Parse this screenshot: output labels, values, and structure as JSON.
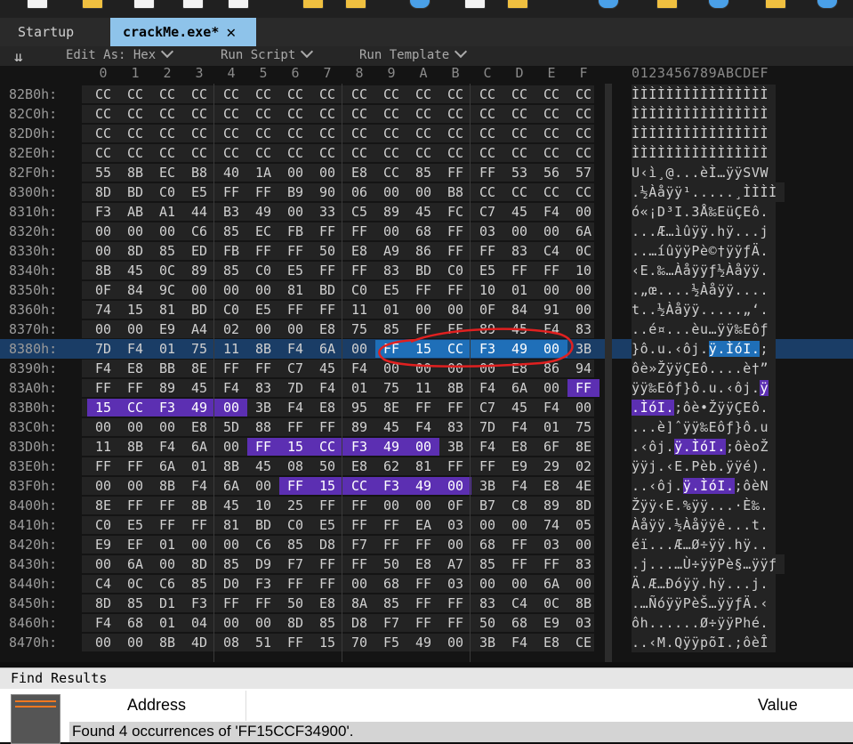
{
  "tabs": {
    "startup": "Startup",
    "active": "crackMe.exe*",
    "close_glyph": "✕"
  },
  "editor_bar": {
    "icon": "double-chevron-down-icon",
    "edit_as": "Edit As: Hex",
    "run_script": "Run Script",
    "run_template": "Run Template"
  },
  "columns": [
    "0",
    "1",
    "2",
    "3",
    "4",
    "5",
    "6",
    "7",
    "8",
    "9",
    "A",
    "B",
    "C",
    "D",
    "E",
    "F"
  ],
  "ascii_header": "0123456789ABCDEF",
  "rows": [
    {
      "addr": "82B0h:",
      "bytes": [
        "CC",
        "CC",
        "CC",
        "CC",
        "CC",
        "CC",
        "CC",
        "CC",
        "CC",
        "CC",
        "CC",
        "CC",
        "CC",
        "CC",
        "CC",
        "CC"
      ],
      "ascii": "ÌÌÌÌÌÌÌÌÌÌÌÌÌÌÌÌ"
    },
    {
      "addr": "82C0h:",
      "bytes": [
        "CC",
        "CC",
        "CC",
        "CC",
        "CC",
        "CC",
        "CC",
        "CC",
        "CC",
        "CC",
        "CC",
        "CC",
        "CC",
        "CC",
        "CC",
        "CC"
      ],
      "ascii": "ÌÌÌÌÌÌÌÌÌÌÌÌÌÌÌÌ"
    },
    {
      "addr": "82D0h:",
      "bytes": [
        "CC",
        "CC",
        "CC",
        "CC",
        "CC",
        "CC",
        "CC",
        "CC",
        "CC",
        "CC",
        "CC",
        "CC",
        "CC",
        "CC",
        "CC",
        "CC"
      ],
      "ascii": "ÌÌÌÌÌÌÌÌÌÌÌÌÌÌÌÌ"
    },
    {
      "addr": "82E0h:",
      "bytes": [
        "CC",
        "CC",
        "CC",
        "CC",
        "CC",
        "CC",
        "CC",
        "CC",
        "CC",
        "CC",
        "CC",
        "CC",
        "CC",
        "CC",
        "CC",
        "CC"
      ],
      "ascii": "ÌÌÌÌÌÌÌÌÌÌÌÌÌÌÌÌ"
    },
    {
      "addr": "82F0h:",
      "bytes": [
        "55",
        "8B",
        "EC",
        "B8",
        "40",
        "1A",
        "00",
        "00",
        "E8",
        "CC",
        "85",
        "FF",
        "FF",
        "53",
        "56",
        "57"
      ],
      "ascii": "U‹ì¸@...èÌ…ÿÿSVW"
    },
    {
      "addr": "8300h:",
      "bytes": [
        "8D",
        "BD",
        "C0",
        "E5",
        "FF",
        "FF",
        "B9",
        "90",
        "06",
        "00",
        "00",
        "B8",
        "CC",
        "CC",
        "CC",
        "CC"
      ],
      "ascii": ".½Àåÿÿ¹.....¸ÌÌÌÌ"
    },
    {
      "addr": "8310h:",
      "bytes": [
        "F3",
        "AB",
        "A1",
        "44",
        "B3",
        "49",
        "00",
        "33",
        "C5",
        "89",
        "45",
        "FC",
        "C7",
        "45",
        "F4",
        "00"
      ],
      "ascii": "ó«¡D³I.3Å‰EüÇEô."
    },
    {
      "addr": "8320h:",
      "bytes": [
        "00",
        "00",
        "00",
        "C6",
        "85",
        "EC",
        "FB",
        "FF",
        "FF",
        "00",
        "68",
        "FF",
        "03",
        "00",
        "00",
        "6A"
      ],
      "ascii": "...Æ…ìûÿÿ.hÿ...j"
    },
    {
      "addr": "8330h:",
      "bytes": [
        "00",
        "8D",
        "85",
        "ED",
        "FB",
        "FF",
        "FF",
        "50",
        "E8",
        "A9",
        "86",
        "FF",
        "FF",
        "83",
        "C4",
        "0C"
      ],
      "ascii": "..…íûÿÿPè©†ÿÿƒÄ."
    },
    {
      "addr": "8340h:",
      "bytes": [
        "8B",
        "45",
        "0C",
        "89",
        "85",
        "C0",
        "E5",
        "FF",
        "FF",
        "83",
        "BD",
        "C0",
        "E5",
        "FF",
        "FF",
        "10"
      ],
      "ascii": "‹E.‰…Àåÿÿƒ½Àåÿÿ."
    },
    {
      "addr": "8350h:",
      "bytes": [
        "0F",
        "84",
        "9C",
        "00",
        "00",
        "00",
        "81",
        "BD",
        "C0",
        "E5",
        "FF",
        "FF",
        "10",
        "01",
        "00",
        "00"
      ],
      "ascii": ".„œ....½Àåÿÿ...."
    },
    {
      "addr": "8360h:",
      "bytes": [
        "74",
        "15",
        "81",
        "BD",
        "C0",
        "E5",
        "FF",
        "FF",
        "11",
        "01",
        "00",
        "00",
        "0F",
        "84",
        "91",
        "00"
      ],
      "ascii": "t..½Àåÿÿ.....„‘."
    },
    {
      "addr": "8370h:",
      "bytes": [
        "00",
        "00",
        "E9",
        "A4",
        "02",
        "00",
        "00",
        "E8",
        "75",
        "85",
        "FF",
        "FF",
        "89",
        "45",
        "F4",
        "83"
      ],
      "ascii": "..é¤...èu…ÿÿ‰Eôƒ"
    },
    {
      "addr": "8380h:",
      "bytes": [
        "7D",
        "F4",
        "01",
        "75",
        "11",
        "8B",
        "F4",
        "6A",
        "00",
        "FF",
        "15",
        "CC",
        "F3",
        "49",
        "00",
        "3B"
      ],
      "ascii": "}ô.u.‹ôj.ÿ.ÌóI.;",
      "cursor": true,
      "sel": [
        9,
        14
      ],
      "asel": [
        9,
        14
      ]
    },
    {
      "addr": "8390h:",
      "bytes": [
        "F4",
        "E8",
        "BB",
        "8E",
        "FF",
        "FF",
        "C7",
        "45",
        "F4",
        "00",
        "00",
        "00",
        "00",
        "E8",
        "86",
        "94"
      ],
      "ascii": "ôè»ŽÿÿÇEô....è†”"
    },
    {
      "addr": "83A0h:",
      "bytes": [
        "FF",
        "FF",
        "89",
        "45",
        "F4",
        "83",
        "7D",
        "F4",
        "01",
        "75",
        "11",
        "8B",
        "F4",
        "6A",
        "00",
        "FF"
      ],
      "ascii": "ÿÿ‰Eôƒ}ô.u.‹ôj.ÿ",
      "hl": [
        15,
        15
      ],
      "ahl": [
        15,
        15
      ]
    },
    {
      "addr": "83B0h:",
      "bytes": [
        "15",
        "CC",
        "F3",
        "49",
        "00",
        "3B",
        "F4",
        "E8",
        "95",
        "8E",
        "FF",
        "FF",
        "C7",
        "45",
        "F4",
        "00"
      ],
      "ascii": ".ÌóI.;ôè•ŽÿÿÇEô.",
      "hl": [
        0,
        4
      ],
      "ahl": [
        0,
        4
      ]
    },
    {
      "addr": "83C0h:",
      "bytes": [
        "00",
        "00",
        "00",
        "E8",
        "5D",
        "88",
        "FF",
        "FF",
        "89",
        "45",
        "F4",
        "83",
        "7D",
        "F4",
        "01",
        "75"
      ],
      "ascii": "...è]ˆÿÿ‰Eôƒ}ô.u"
    },
    {
      "addr": "83D0h:",
      "bytes": [
        "11",
        "8B",
        "F4",
        "6A",
        "00",
        "FF",
        "15",
        "CC",
        "F3",
        "49",
        "00",
        "3B",
        "F4",
        "E8",
        "6F",
        "8E"
      ],
      "ascii": ".‹ôj.ÿ.ÌóI.;ôèoŽ",
      "hl": [
        5,
        10
      ],
      "ahl": [
        5,
        10
      ]
    },
    {
      "addr": "83E0h:",
      "bytes": [
        "FF",
        "FF",
        "6A",
        "01",
        "8B",
        "45",
        "08",
        "50",
        "E8",
        "62",
        "81",
        "FF",
        "FF",
        "E9",
        "29",
        "02"
      ],
      "ascii": "ÿÿj.‹E.Pèb.ÿÿé)."
    },
    {
      "addr": "83F0h:",
      "bytes": [
        "00",
        "00",
        "8B",
        "F4",
        "6A",
        "00",
        "FF",
        "15",
        "CC",
        "F3",
        "49",
        "00",
        "3B",
        "F4",
        "E8",
        "4E"
      ],
      "ascii": "..‹ôj.ÿ.ÌóI.;ôèN",
      "hl": [
        6,
        11
      ],
      "ahl": [
        6,
        11
      ]
    },
    {
      "addr": "8400h:",
      "bytes": [
        "8E",
        "FF",
        "FF",
        "8B",
        "45",
        "10",
        "25",
        "FF",
        "FF",
        "00",
        "00",
        "0F",
        "B7",
        "C8",
        "89",
        "8D"
      ],
      "ascii": "Žÿÿ‹E.%ÿÿ...·È‰."
    },
    {
      "addr": "8410h:",
      "bytes": [
        "C0",
        "E5",
        "FF",
        "FF",
        "81",
        "BD",
        "C0",
        "E5",
        "FF",
        "FF",
        "EA",
        "03",
        "00",
        "00",
        "74",
        "05"
      ],
      "ascii": "Àåÿÿ.½Àåÿÿê...t."
    },
    {
      "addr": "8420h:",
      "bytes": [
        "E9",
        "EF",
        "01",
        "00",
        "00",
        "C6",
        "85",
        "D8",
        "F7",
        "FF",
        "FF",
        "00",
        "68",
        "FF",
        "03",
        "00"
      ],
      "ascii": "éï...Æ…Ø÷ÿÿ.hÿ.."
    },
    {
      "addr": "8430h:",
      "bytes": [
        "00",
        "6A",
        "00",
        "8D",
        "85",
        "D9",
        "F7",
        "FF",
        "FF",
        "50",
        "E8",
        "A7",
        "85",
        "FF",
        "FF",
        "83"
      ],
      "ascii": ".j...…Ù÷ÿÿPè§…ÿÿƒ"
    },
    {
      "addr": "8440h:",
      "bytes": [
        "C4",
        "0C",
        "C6",
        "85",
        "D0",
        "F3",
        "FF",
        "FF",
        "00",
        "68",
        "FF",
        "03",
        "00",
        "00",
        "6A",
        "00"
      ],
      "ascii": "Ä.Æ…Ðóÿÿ.hÿ...j."
    },
    {
      "addr": "8450h:",
      "bytes": [
        "8D",
        "85",
        "D1",
        "F3",
        "FF",
        "FF",
        "50",
        "E8",
        "8A",
        "85",
        "FF",
        "FF",
        "83",
        "C4",
        "0C",
        "8B"
      ],
      "ascii": ".…ÑóÿÿPèŠ…ÿÿƒÄ.‹"
    },
    {
      "addr": "8460h:",
      "bytes": [
        "F4",
        "68",
        "01",
        "04",
        "00",
        "00",
        "8D",
        "85",
        "D8",
        "F7",
        "FF",
        "FF",
        "50",
        "68",
        "E9",
        "03"
      ],
      "ascii": "ôh......Ø÷ÿÿPhé."
    },
    {
      "addr": "8470h:",
      "bytes": [
        "00",
        "00",
        "8B",
        "4D",
        "08",
        "51",
        "FF",
        "15",
        "70",
        "F5",
        "49",
        "00",
        "3B",
        "F4",
        "E8",
        "CE"
      ],
      "ascii": "..‹M.QÿÿpõI.;ôèÎ"
    }
  ],
  "find": {
    "title": "Find Results",
    "col_address": "Address",
    "col_value": "Value",
    "message": "Found 4 occurrences of 'FF15CCF34900'."
  },
  "colors": {
    "selection": "#1f6fb8",
    "highlight": "#5c2fb2",
    "annotation": "#e02020",
    "tab_active": "#8ec3ea"
  }
}
